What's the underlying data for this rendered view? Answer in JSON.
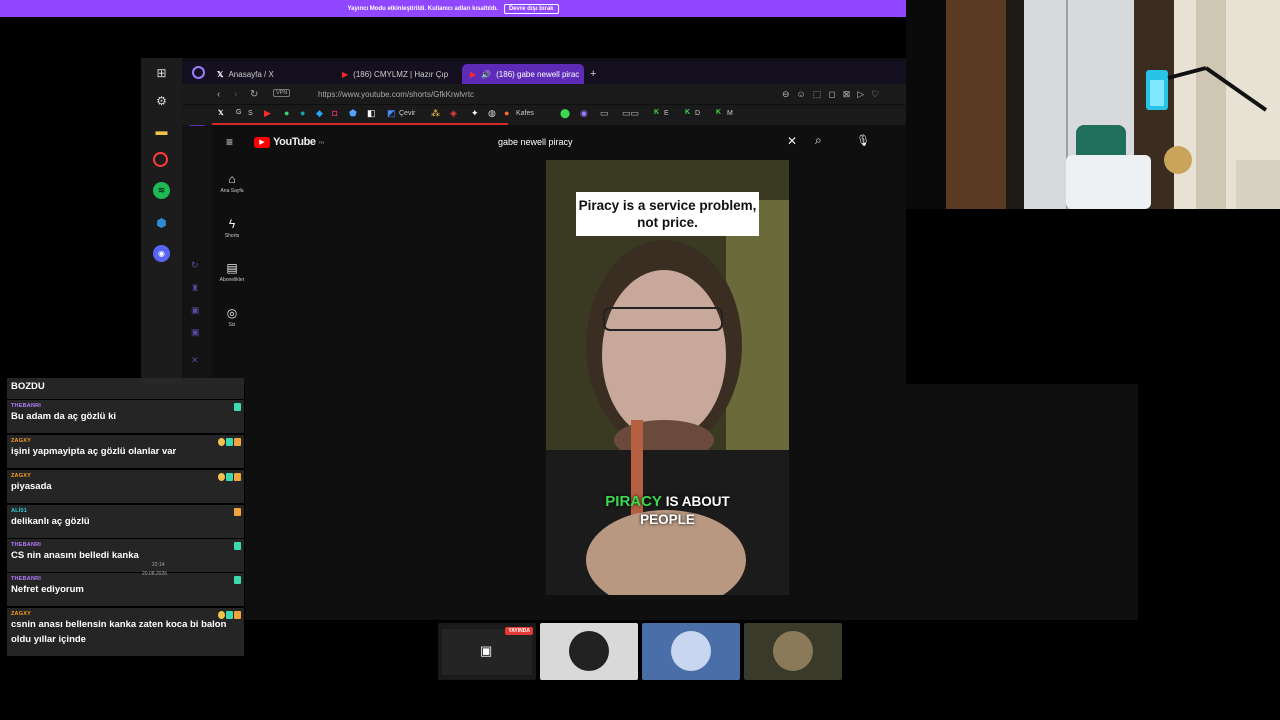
{
  "banner": {
    "text": "Yayıncı Modu etkinleştirildi. Kullanıcı adları kısaltıldı.",
    "button": "Devre dışı bırak"
  },
  "browser": {
    "tabs": [
      {
        "label": "Anasayfa / X",
        "icon": "x-logo-icon"
      },
      {
        "label": "(186) CMYLMZ | Hazır Çıp",
        "icon": "youtube-icon"
      },
      {
        "label": "(186) gabe newell pirac",
        "icon": "youtube-icon"
      }
    ],
    "new_tab": "+",
    "vpn_label": "VPN",
    "url": "https://www.youtube.com/shorts/GfkKrwlvrtc",
    "bookmarks": [
      "S",
      "Çevir",
      "Kafes",
      "E",
      "D",
      "M"
    ]
  },
  "youtube": {
    "logo": "YouTube",
    "logo_sup": "TR",
    "search_value": "gabe newell piracy",
    "nav": [
      "Ana Sayfa",
      "Shorts",
      "Abonelikler",
      "Siz"
    ]
  },
  "video": {
    "caption_top": "Piracy is a service problem, not price.",
    "caption_bottom_highlight": "PIRACY",
    "caption_bottom_rest1": " IS ABOUT",
    "caption_bottom_rest2": "PEOPLE"
  },
  "chat": {
    "partial_top": "BOZDU",
    "messages": [
      {
        "user": "THEBANRI",
        "user_color": "#b57cff",
        "text": "Bu adam da aç gözlü ki"
      },
      {
        "user": "ZAGXY",
        "user_color": "#ff9f1a",
        "text": "işini yapmayipta aç gözlü olanlar var"
      },
      {
        "user": "ZAGXY",
        "user_color": "#ff9f1a",
        "text": "piyasada"
      },
      {
        "user": "ALİ01",
        "user_color": "#27d4e0",
        "text": "delikanlı aç gözlü"
      },
      {
        "user": "THEBANRI",
        "user_color": "#b57cff",
        "text": "CS nin anasını belledi kanka"
      },
      {
        "user": "THEBANRI",
        "user_color": "#b57cff",
        "text": "Nefret ediyorum"
      },
      {
        "user": "ZAGXY",
        "user_color": "#ff9f1a",
        "text": "csnin anası bellensin kanka zaten koca bi balon oldu yıllar içinde"
      }
    ]
  },
  "tray": {
    "time": "22:14",
    "date": "20.08.2026"
  },
  "streams": {
    "live_badge": "YAYINDA"
  }
}
